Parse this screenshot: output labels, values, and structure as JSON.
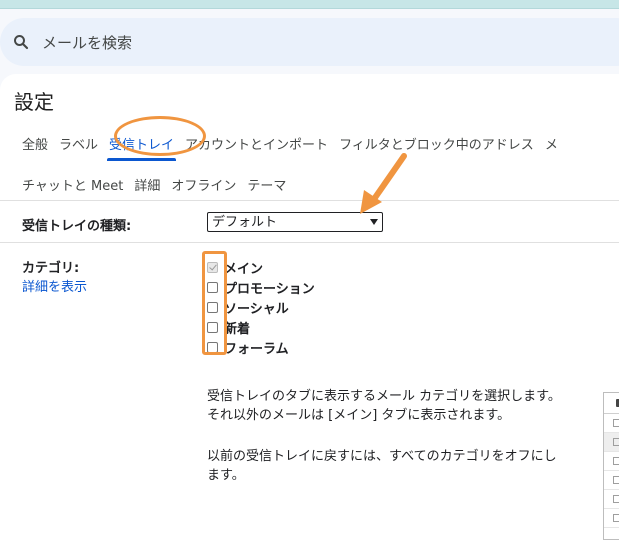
{
  "search": {
    "placeholder": "メールを検索"
  },
  "settings": {
    "title": "設定"
  },
  "tabs_row1": [
    "全般",
    "ラベル",
    "受信トレイ",
    "アカウントとインポート",
    "フィルタとブロック中のアドレス",
    "メ"
  ],
  "tabs_row2": [
    "チャットと Meet",
    "詳細",
    "オフライン",
    "テーマ"
  ],
  "active_tab": "受信トレイ",
  "inbox_type": {
    "label": "受信トレイの種類:",
    "selected": "デフォルト"
  },
  "categories": {
    "label": "カテゴリ:",
    "link": "詳細を表示",
    "items": [
      {
        "label": "メイン",
        "checked": true,
        "disabled": true
      },
      {
        "label": "プロモーション",
        "checked": false
      },
      {
        "label": "ソーシャル",
        "checked": false
      },
      {
        "label": "新着",
        "checked": false
      },
      {
        "label": "フォーラム",
        "checked": false
      }
    ]
  },
  "description": {
    "p1": "受信トレイのタブに表示するメール カテゴリを選択します。それ以外のメールは [メイン] タブに表示されます。",
    "p2": "以前の受信トレイに戻すには、すべてのカテゴリをオフにします。"
  },
  "colors": {
    "accent": "#0b57d0",
    "annotation": "#f09540",
    "background": "#f6f8fc"
  },
  "icons": {
    "search": "search-icon",
    "dropdown": "chevron-down-icon"
  }
}
